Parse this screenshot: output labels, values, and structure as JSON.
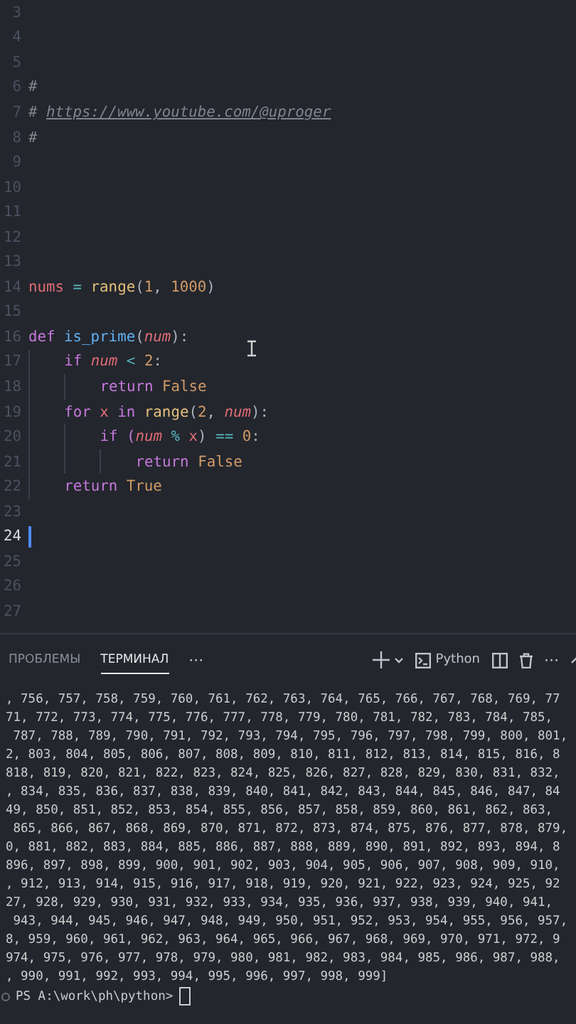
{
  "editor": {
    "lines": [
      {
        "number": "3",
        "current": false
      },
      {
        "number": "4",
        "current": false
      },
      {
        "number": "5",
        "current": false
      },
      {
        "number": "6",
        "current": false,
        "tokens": [
          {
            "text": "#",
            "kind": "comment"
          }
        ]
      },
      {
        "number": "7",
        "current": false,
        "tokens": [
          {
            "text": "# ",
            "kind": "comment"
          },
          {
            "text": "https://www.youtube.com/@uproger",
            "kind": "link"
          }
        ]
      },
      {
        "number": "8",
        "current": false,
        "tokens": [
          {
            "text": "#",
            "kind": "comment"
          }
        ]
      },
      {
        "number": "9",
        "current": false
      },
      {
        "number": "10",
        "current": false
      },
      {
        "number": "11",
        "current": false
      },
      {
        "number": "12",
        "current": false
      },
      {
        "number": "13",
        "current": false
      },
      {
        "number": "14",
        "current": false,
        "tokens": [
          {
            "text": "nums ",
            "kind": "variable"
          },
          {
            "text": "= ",
            "kind": "operator"
          },
          {
            "text": "range",
            "kind": "builtin"
          },
          {
            "text": "(",
            "kind": "plain"
          },
          {
            "text": "1",
            "kind": "number"
          },
          {
            "text": ", ",
            "kind": "plain"
          },
          {
            "text": "1000",
            "kind": "number"
          },
          {
            "text": ")",
            "kind": "plain"
          }
        ]
      },
      {
        "number": "15",
        "current": false
      },
      {
        "number": "16",
        "current": false,
        "tokens": [
          {
            "text": "def ",
            "kind": "keyword"
          },
          {
            "text": "is_prime",
            "kind": "function"
          },
          {
            "text": "(",
            "kind": "plain"
          },
          {
            "text": "num",
            "kind": "param"
          },
          {
            "text": "):",
            "kind": "plain"
          }
        ],
        "children": [
          {
            "number": "17",
            "current": false,
            "tokens": [
              {
                "text": "if ",
                "kind": "keyword"
              },
              {
                "text": "num",
                "kind": "param"
              },
              {
                "text": " < ",
                "kind": "operator"
              },
              {
                "text": "2",
                "kind": "number"
              },
              {
                "text": ":",
                "kind": "plain"
              }
            ],
            "children": [
              {
                "number": "18",
                "current": false,
                "tokens": [
                  {
                    "text": "return ",
                    "kind": "keyword"
                  },
                  {
                    "text": "False",
                    "kind": "constant"
                  }
                ]
              }
            ]
          },
          {
            "number": "19",
            "current": false,
            "tokens": [
              {
                "text": "for ",
                "kind": "keyword"
              },
              {
                "text": "x ",
                "kind": "variable"
              },
              {
                "text": "in ",
                "kind": "keyword"
              },
              {
                "text": "range",
                "kind": "builtin"
              },
              {
                "text": "(",
                "kind": "plain"
              },
              {
                "text": "2",
                "kind": "number"
              },
              {
                "text": ", ",
                "kind": "plain"
              },
              {
                "text": "num",
                "kind": "param"
              },
              {
                "text": "):",
                "kind": "plain"
              }
            ],
            "children": [
              {
                "number": "20",
                "current": false,
                "tokens": [
                  {
                    "text": "if (",
                    "kind": "keyword"
                  },
                  {
                    "text": "num",
                    "kind": "param"
                  },
                  {
                    "text": " % ",
                    "kind": "operator"
                  },
                  {
                    "text": "x",
                    "kind": "variable"
                  },
                  {
                    "text": ") ",
                    "kind": "plain"
                  },
                  {
                    "text": "== ",
                    "kind": "operator"
                  },
                  {
                    "text": "0",
                    "kind": "number"
                  },
                  {
                    "text": ":",
                    "kind": "plain"
                  }
                ],
                "children": [
                  {
                    "number": "21",
                    "current": false,
                    "tokens": [
                      {
                        "text": "return ",
                        "kind": "keyword"
                      },
                      {
                        "text": "False",
                        "kind": "constant"
                      }
                    ]
                  }
                ]
              }
            ]
          },
          {
            "number": "22",
            "current": false,
            "tokens": [
              {
                "text": "return ",
                "kind": "keyword"
              },
              {
                "text": "True",
                "kind": "constant"
              }
            ]
          }
        ]
      },
      {
        "number": "23",
        "current": false
      },
      {
        "number": "24",
        "current": true
      },
      {
        "number": "25",
        "current": false
      },
      {
        "number": "26",
        "current": false
      },
      {
        "number": "27",
        "current": false
      }
    ]
  },
  "panel": {
    "tabs": [
      {
        "label": "ПРОБЛЕМЫ",
        "selected": false
      },
      {
        "label": "ТЕРМИНАЛ",
        "selected": true
      }
    ],
    "more": "···",
    "terminal_name": "Python",
    "actions_more": "···"
  },
  "terminal": {
    "lines": [
      ", 756, 757, 758, 759, 760, 761, 762, 763, 764, 765, 766, 767, 768, 769, 77",
      "71, 772, 773, 774, 775, 776, 777, 778, 779, 780, 781, 782, 783, 784, 785,",
      " 787, 788, 789, 790, 791, 792, 793, 794, 795, 796, 797, 798, 799, 800, 801,",
      "2, 803, 804, 805, 806, 807, 808, 809, 810, 811, 812, 813, 814, 815, 816, 8",
      "818, 819, 820, 821, 822, 823, 824, 825, 826, 827, 828, 829, 830, 831, 832,",
      ", 834, 835, 836, 837, 838, 839, 840, 841, 842, 843, 844, 845, 846, 847, 84",
      "49, 850, 851, 852, 853, 854, 855, 856, 857, 858, 859, 860, 861, 862, 863,",
      " 865, 866, 867, 868, 869, 870, 871, 872, 873, 874, 875, 876, 877, 878, 879,",
      "0, 881, 882, 883, 884, 885, 886, 887, 888, 889, 890, 891, 892, 893, 894, 8",
      "896, 897, 898, 899, 900, 901, 902, 903, 904, 905, 906, 907, 908, 909, 910,",
      ", 912, 913, 914, 915, 916, 917, 918, 919, 920, 921, 922, 923, 924, 925, 92",
      "27, 928, 929, 930, 931, 932, 933, 934, 935, 936, 937, 938, 939, 940, 941,",
      " 943, 944, 945, 946, 947, 948, 949, 950, 951, 952, 953, 954, 955, 956, 957,",
      "8, 959, 960, 961, 962, 963, 964, 965, 966, 967, 968, 969, 970, 971, 972, 9",
      "974, 975, 976, 977, 978, 979, 980, 981, 982, 983, 984, 985, 986, 987, 988,",
      ", 990, 991, 992, 993, 994, 995, 996, 997, 998, 999]"
    ],
    "prompt": "PS A:\\work\\ph\\python>"
  }
}
